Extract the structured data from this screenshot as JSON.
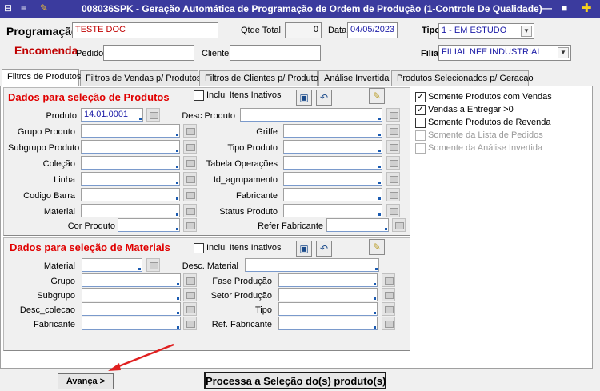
{
  "window": {
    "title": "008036SPK - Geração Automática de Programação de Ordem de Produção (1-Controle De Qualidade)",
    "controls": [
      "—",
      "■",
      "✚"
    ]
  },
  "header": {
    "programacao_label": "Programação",
    "programacao_value": "TESTE DOC",
    "qtde_total_label": "Qtde Total",
    "qtde_total_value": "0",
    "data_label": "Data",
    "data_value": "04/05/2023",
    "tipo_label": "Tipo",
    "tipo_value": "1 - EM ESTUDO",
    "encomenda_label": "Encomenda",
    "pedido_label": "Pedido",
    "pedido_value": "",
    "cliente_label": "Cliente",
    "cliente_value": "",
    "filial_label": "Filial",
    "filial_value": "FILIAL NFE INDUSTRIAL"
  },
  "tabs": [
    "Filtros de Produtos",
    "Filtros de Vendas p/ Produtos",
    "Filtros de Clientes p/ Produtos",
    "Análise Invertida",
    "Produtos Selecionados p/ Geracao"
  ],
  "produtos": {
    "title": "Dados para seleção de Produtos",
    "include_inactive": "Inclui Itens Inativos",
    "produto_label": "Produto",
    "produto_value": "14.01.0001",
    "desc_produto_label": "Desc Produto",
    "left_labels": [
      "Grupo Produto",
      "Subgrupo Produto",
      "Coleção",
      "Linha",
      "Codigo Barra",
      "Material"
    ],
    "right_labels": [
      "Griffe",
      "Tipo Produto",
      "Tabela Operações",
      "Id_agrupamento",
      "Fabricante",
      "Status Produto"
    ],
    "cor_produto_label": "Cor Produto",
    "refer_fabricante_label": "Refer Fabricante"
  },
  "materiais": {
    "title": "Dados para seleção de Materiais",
    "include_inactive": "Inclui Itens Inativos",
    "material_label": "Material",
    "desc_material_label": "Desc. Material",
    "left_labels": [
      "Grupo",
      "Subgrupo",
      "Desc_colecao",
      "Fabricante"
    ],
    "right_labels": [
      "Fase Produção",
      "Setor Produção",
      "Tipo",
      "Ref. Fabricante"
    ]
  },
  "options": [
    {
      "label": "Somente Produtos com Vendas",
      "checked": true,
      "enabled": true
    },
    {
      "label": "Vendas a Entregar >0",
      "checked": true,
      "enabled": true
    },
    {
      "label": "Somente Produtos de Revenda",
      "checked": false,
      "enabled": true
    },
    {
      "label": "Somente da Lista de Pedidos",
      "checked": false,
      "enabled": false
    },
    {
      "label": "Somente da Análise Invertida",
      "checked": false,
      "enabled": false
    }
  ],
  "buttons": {
    "avanca": "Avança >",
    "processa": "Processa a Seleção do(s) produto(s)"
  },
  "colors": {
    "titlebar": "#3b3b9e",
    "group_title": "#e00000",
    "annotation_arrow": "#e02020"
  }
}
